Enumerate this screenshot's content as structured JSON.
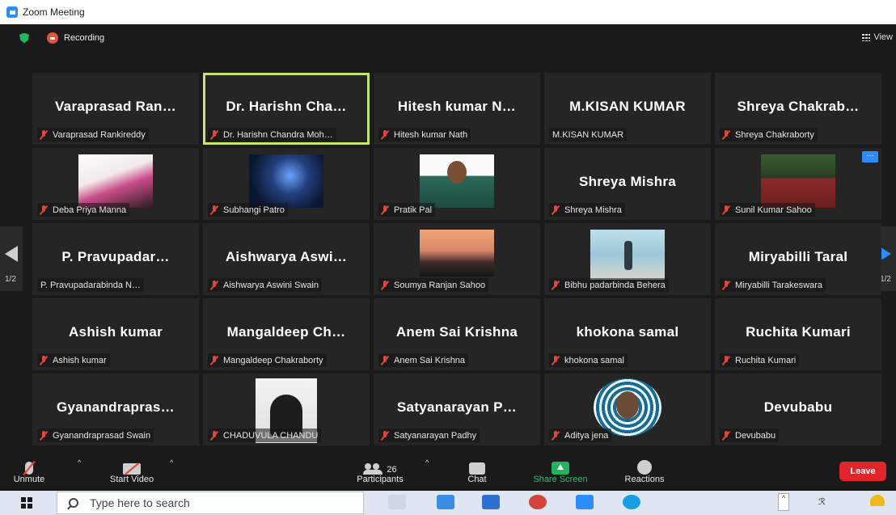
{
  "window": {
    "title": "Zoom Meeting"
  },
  "topbar": {
    "recording_label": "Recording",
    "view_label": "View"
  },
  "pagination": {
    "left": "1/2",
    "right": "1/2"
  },
  "tiles": [
    {
      "big": "Varaprasad Ran…",
      "label": "Varaprasad Rankireddy",
      "muted": true
    },
    {
      "big": "Dr. Harishn Cha…",
      "label": "Dr. Harishn Chandra Moh…",
      "muted": true,
      "active": true
    },
    {
      "big": "Hitesh kumar N…",
      "label": "Hitesh kumar Nath",
      "muted": true
    },
    {
      "big": "M.KISAN KUMAR",
      "label": "M.KISAN KUMAR",
      "muted": false
    },
    {
      "big": "Shreya Chakrab…",
      "label": "Shreya Chakraborty",
      "muted": true
    },
    {
      "big": "",
      "label": "Deba Priya Manna",
      "muted": true,
      "photo": "ph-deba"
    },
    {
      "big": "",
      "label": "Subhangi Patro",
      "muted": true,
      "photo": "ph-subhangi"
    },
    {
      "big": "",
      "label": "Pratik Pal",
      "muted": true,
      "photo": "ph-pratik"
    },
    {
      "big": "Shreya Mishra",
      "label": "Shreya Mishra",
      "muted": true
    },
    {
      "big": "",
      "label": "Sunil Kumar Sahoo",
      "muted": true,
      "photo": "ph-sunil",
      "more": true
    },
    {
      "big": "P. Pravupadar…",
      "label": "P. Pravupadarabinda N…",
      "muted": false
    },
    {
      "big": "Aishwarya Aswi…",
      "label": "Aishwarya Aswini Swain",
      "muted": true
    },
    {
      "big": "",
      "label": "Soumya Ranjan Sahoo",
      "muted": true,
      "photo": "ph-soumya"
    },
    {
      "big": "",
      "label": "Bibhu padarbinda Behera",
      "muted": true,
      "photo": "ph-bibhu"
    },
    {
      "big": "Miryabilli Taral",
      "label": "Miryabilli Tarakeswara",
      "muted": true
    },
    {
      "big": "Ashish kumar",
      "label": "Ashish kumar",
      "muted": true
    },
    {
      "big": "Mangaldeep Ch…",
      "label": "Mangaldeep Chakraborty",
      "muted": true
    },
    {
      "big": "Anem Sai Krishna",
      "label": "Anem Sai Krishna",
      "muted": true
    },
    {
      "big": "khokona samal",
      "label": "khokona samal",
      "muted": true
    },
    {
      "big": "Ruchita Kumari",
      "label": "Ruchita Kumari",
      "muted": true
    },
    {
      "big": "Gyanandrapras…",
      "label": "Gyanandraprasad Swain",
      "muted": true
    },
    {
      "big": "",
      "label": "CHADUVULA CHANDU",
      "muted": true,
      "photo": "ph-chandu"
    },
    {
      "big": "Satyanarayan P…",
      "label": "Satyanarayan Padhy",
      "muted": true
    },
    {
      "big": "",
      "label": "Aditya jena",
      "muted": true,
      "photo": "ph-aditya"
    },
    {
      "big": "Devubabu",
      "label": "Devubabu",
      "muted": true
    }
  ],
  "controls": {
    "unmute": "Unmute",
    "start_video": "Start Video",
    "participants_count": "26",
    "participants": "Participants",
    "chat": "Chat",
    "share_screen": "Share Screen",
    "reactions": "Reactions",
    "leave": "Leave"
  },
  "taskbar": {
    "search_placeholder": "Type here to search"
  },
  "colors": {
    "active_speaker": "#c6e36b",
    "leave": "#e0262b",
    "share": "#23b35f",
    "accent": "#2d8cff"
  }
}
